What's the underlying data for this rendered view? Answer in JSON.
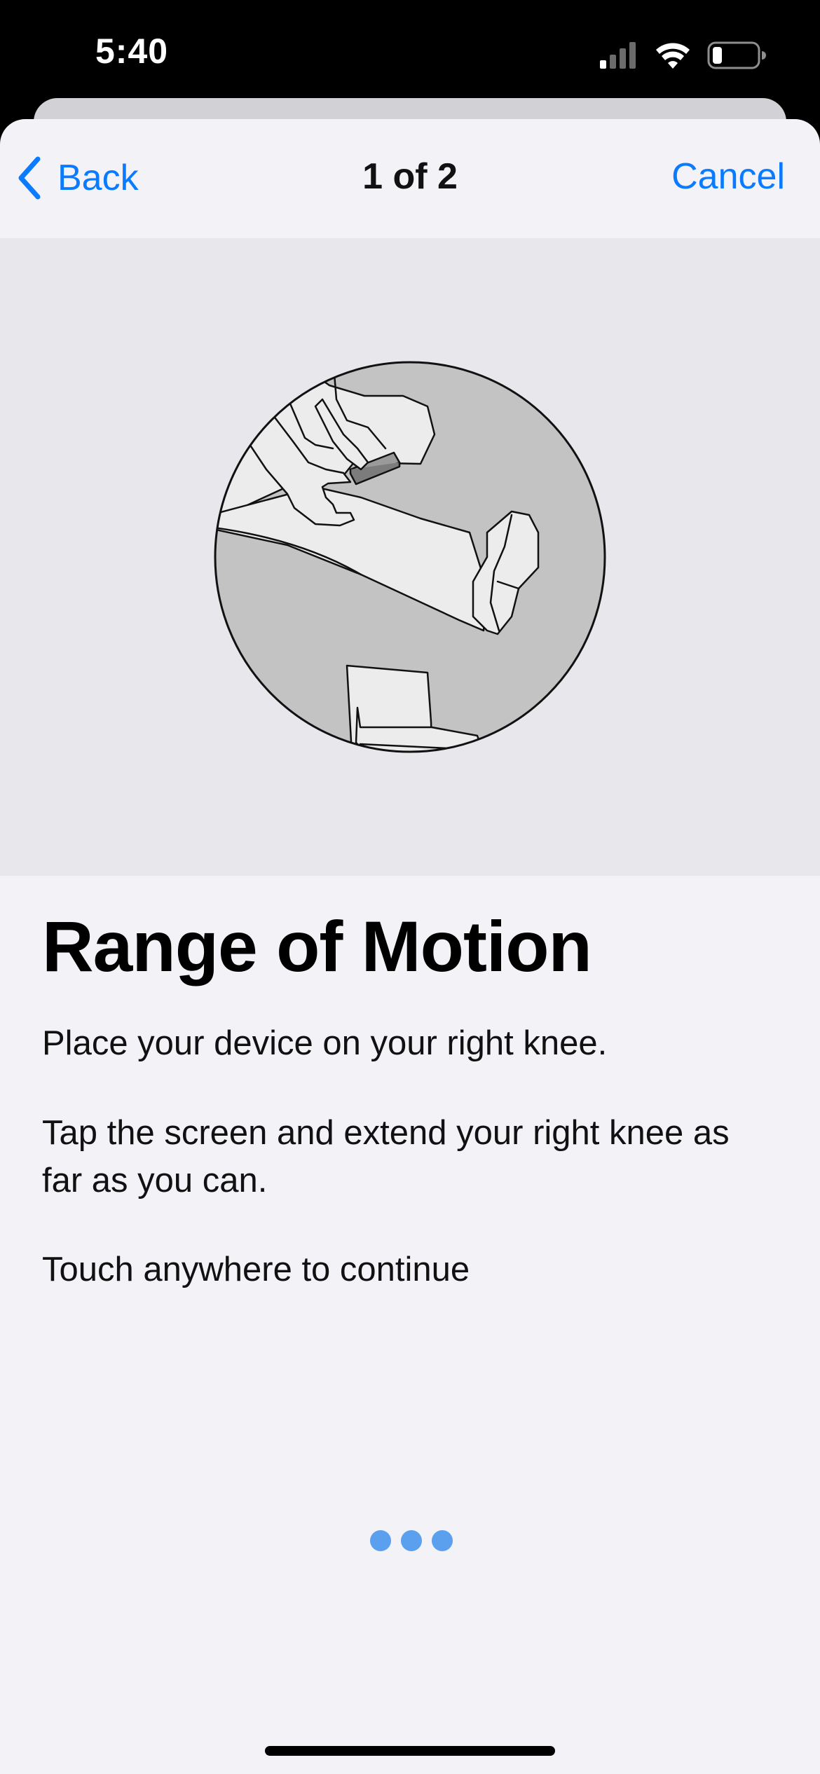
{
  "status_bar": {
    "time": "5:40"
  },
  "nav": {
    "back_label": "Back",
    "title": "1 of 2",
    "cancel_label": "Cancel"
  },
  "content": {
    "title": "Range of Motion",
    "instruction_1": "Place your device on your right knee.",
    "instruction_2": "Tap the screen and extend your right knee as far as you can.",
    "prompt": "Touch anywhere to continue"
  },
  "colors": {
    "accent": "#0a7aff",
    "background": "#f2f2f7",
    "illustration_bg": "#e7e7ec",
    "dots": "#5aa0ef"
  },
  "icons": [
    "chevron-left-icon",
    "cellular-signal-icon",
    "wifi-icon",
    "battery-icon"
  ]
}
